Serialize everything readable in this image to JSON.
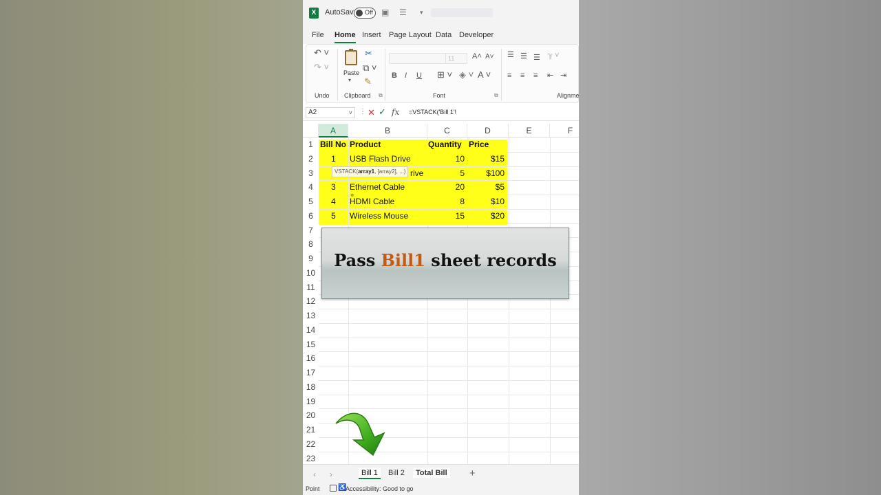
{
  "titlebar": {
    "autosave_label": "AutoSave",
    "toggle_state": "Off"
  },
  "tabs": [
    "File",
    "Home",
    "Insert",
    "Page Layout",
    "Data",
    "Developer"
  ],
  "ribbon": {
    "groups": {
      "undo": "Undo",
      "clipboard": "Clipboard",
      "font": "Font",
      "alignment": "Alignment"
    },
    "paste_label": "Paste",
    "font_size": "11"
  },
  "formula_bar": {
    "name_box": "A2",
    "formula": "=VSTACK('Bill 1'!"
  },
  "columns": [
    "A",
    "B",
    "C",
    "D",
    "E",
    "F"
  ],
  "rows": [
    "1",
    "2",
    "3",
    "4",
    "5",
    "6",
    "7",
    "8",
    "9",
    "10",
    "11",
    "12",
    "13",
    "14",
    "15",
    "16",
    "17",
    "18",
    "19",
    "20",
    "21",
    "22",
    "23"
  ],
  "table": {
    "headers": [
      "Bill No",
      "Product",
      "Quantity",
      "Price"
    ],
    "data": [
      [
        "1",
        "USB Flash Drive",
        "10",
        "$15"
      ],
      [
        "",
        "rive",
        "5",
        "$100"
      ],
      [
        "3",
        "Ethernet Cable",
        "20",
        "$5"
      ],
      [
        "4",
        "HDMI Cable",
        "8",
        "$10"
      ],
      [
        "5",
        "Wireless Mouse",
        "15",
        "$20"
      ]
    ]
  },
  "tooltip": {
    "fn": "VSTACK(",
    "arg1": "array1",
    "rest": ", [array2], ...)"
  },
  "banner": {
    "before": "Pass ",
    "highlight": "Bill1",
    "after": " sheet records"
  },
  "sheet_tabs": [
    "Bill 1",
    "Bill 2",
    "Total Bill"
  ],
  "status": {
    "mode": "Point",
    "accessibility": "Accessibility: Good to go"
  },
  "colors": {
    "excel_green": "#107c41",
    "highlight_yellow": "#ffff1a",
    "banner_accent": "#c55a11",
    "arrow_green": "#3fae1f"
  }
}
